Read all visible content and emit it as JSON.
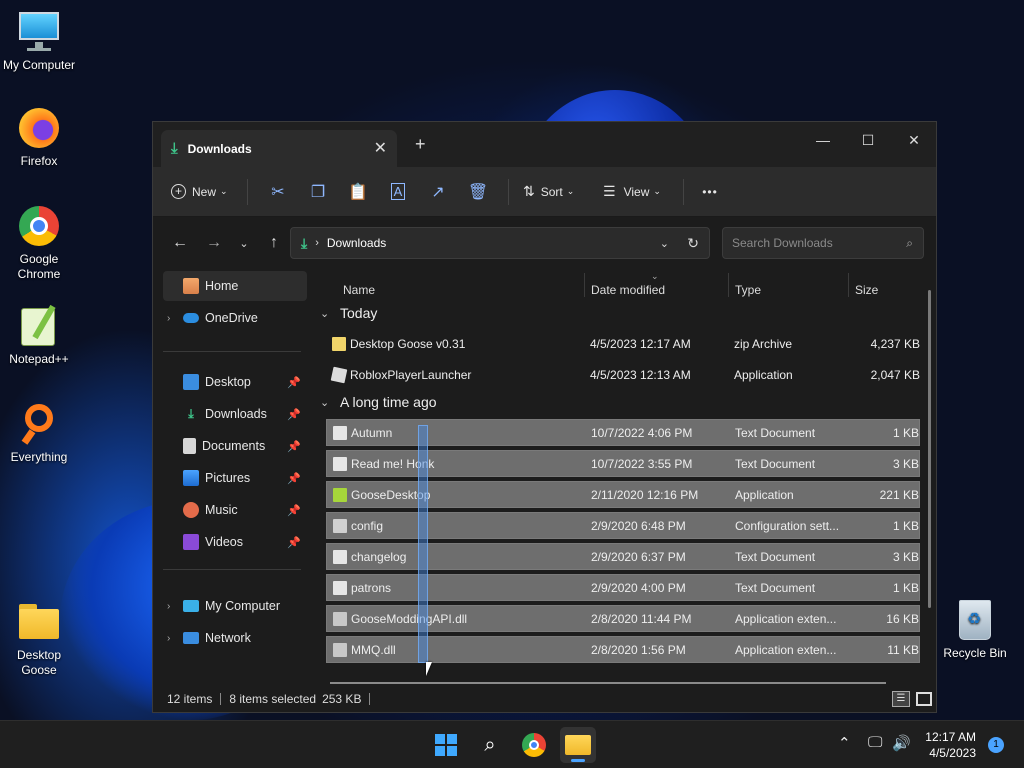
{
  "desktop": {
    "icons": [
      {
        "label": "My Computer"
      },
      {
        "label": "Firefox"
      },
      {
        "label": "Google Chrome"
      },
      {
        "label": "Notepad++"
      },
      {
        "label": "Everything"
      },
      {
        "label": "Desktop Goose"
      },
      {
        "label": "Recycle Bin"
      }
    ]
  },
  "window": {
    "tab_title": "Downloads",
    "toolbar": {
      "new_label": "New",
      "sort_label": "Sort",
      "view_label": "View",
      "more_label": "•••"
    },
    "address": {
      "path": "Downloads"
    },
    "search": {
      "placeholder": "Search Downloads"
    },
    "sidebar": {
      "top": [
        {
          "label": "Home"
        },
        {
          "label": "OneDrive"
        }
      ],
      "quick": [
        {
          "label": "Desktop"
        },
        {
          "label": "Downloads"
        },
        {
          "label": "Documents"
        },
        {
          "label": "Pictures"
        },
        {
          "label": "Music"
        },
        {
          "label": "Videos"
        }
      ],
      "bottom": [
        {
          "label": "My Computer"
        },
        {
          "label": "Network"
        }
      ]
    },
    "columns": {
      "name": "Name",
      "date": "Date modified",
      "type": "Type",
      "size": "Size"
    },
    "groups": [
      {
        "label": "Today"
      },
      {
        "label": "A long time ago"
      }
    ],
    "files": [
      {
        "name": "Desktop Goose v0.31",
        "date": "4/5/2023 12:17 AM",
        "type": "zip Archive",
        "size": "4,237 KB",
        "selected": false
      },
      {
        "name": "RobloxPlayerLauncher",
        "date": "4/5/2023 12:13 AM",
        "type": "Application",
        "size": "2,047 KB",
        "selected": false
      },
      {
        "name": "Autumn",
        "date": "10/7/2022 4:06 PM",
        "type": "Text Document",
        "size": "1 KB",
        "selected": true
      },
      {
        "name": "Read me! Honk",
        "date": "10/7/2022 3:55 PM",
        "type": "Text Document",
        "size": "3 KB",
        "selected": true
      },
      {
        "name": "GooseDesktop",
        "date": "2/11/2020 12:16 PM",
        "type": "Application",
        "size": "221 KB",
        "selected": true
      },
      {
        "name": "config",
        "date": "2/9/2020 6:48 PM",
        "type": "Configuration sett...",
        "size": "1 KB",
        "selected": true
      },
      {
        "name": "changelog",
        "date": "2/9/2020 6:37 PM",
        "type": "Text Document",
        "size": "3 KB",
        "selected": true
      },
      {
        "name": "patrons",
        "date": "2/9/2020 4:00 PM",
        "type": "Text Document",
        "size": "1 KB",
        "selected": true
      },
      {
        "name": "GooseModdingAPI.dll",
        "date": "2/8/2020 11:44 PM",
        "type": "Application exten...",
        "size": "16 KB",
        "selected": true
      },
      {
        "name": "MMQ.dll",
        "date": "2/8/2020 1:56 PM",
        "type": "Application exten...",
        "size": "11 KB",
        "selected": true
      }
    ],
    "status": {
      "items": "12 items",
      "selected": "8 items selected",
      "size": "253 KB"
    }
  },
  "taskbar": {
    "time": "12:17 AM",
    "date": "4/5/2023",
    "notifications": "1"
  },
  "colors": {
    "accent": "#4aa3ff",
    "selection": "#6e6e6e",
    "window_bg": "#1c1c1c"
  }
}
